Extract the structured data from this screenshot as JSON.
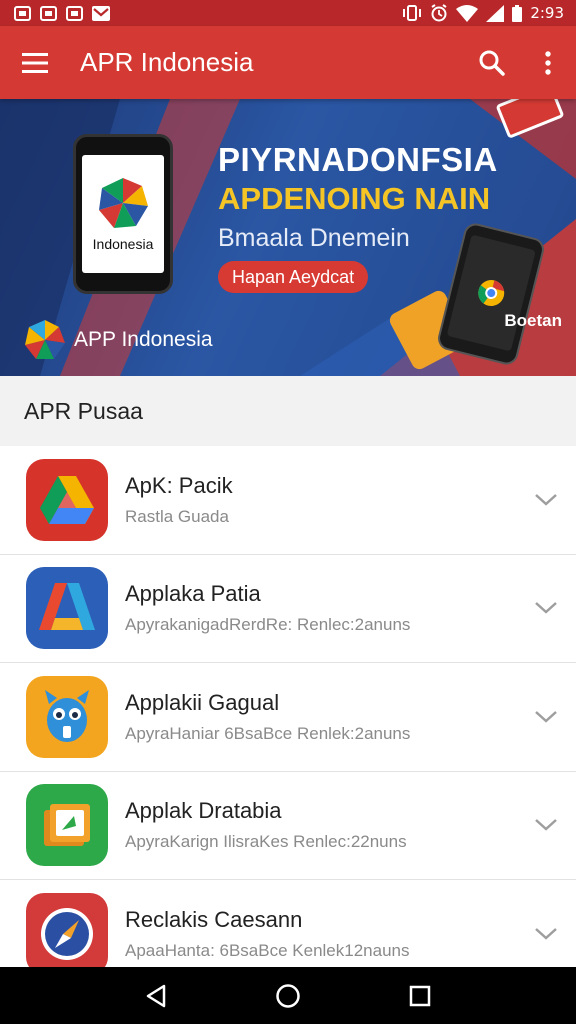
{
  "status_bar": {
    "time": "2:93",
    "icons": [
      "image-icon",
      "photo-icon",
      "gallery-icon",
      "gmail-icon",
      "vibrate-icon",
      "alarm-icon",
      "wifi-icon",
      "signal-icon",
      "battery-icon"
    ]
  },
  "app_bar": {
    "title": "APR Indonesia",
    "menu_icon": "hamburger-menu-icon",
    "search_icon": "search-icon",
    "overflow_icon": "more-vert-icon"
  },
  "banner": {
    "headline": "PIYRNADONFSIA",
    "subheadline": "APDENOING NAIN",
    "tagline": "Bmaala Dnemein",
    "cta_label": "Hapan Aeydcat",
    "phone_label": "Indonesia",
    "brand_text": "APP Indonesia",
    "corner_text": "Boetan"
  },
  "section": {
    "title": "APR Pusaa"
  },
  "apps": [
    {
      "title": "ApK: Pacik",
      "subtitle": "Rastla Guada",
      "icon": "drive-style-icon",
      "colors": [
        "#d6332a",
        "#f4b400",
        "#0f9d58",
        "#4285f4"
      ]
    },
    {
      "title": "Applaka Patia",
      "subtitle": "ApyrakanigadRerdRe: Renlec:2anuns",
      "icon": "triangle-a-icon",
      "colors": [
        "#2c5fb8",
        "#e94a2f",
        "#2fa8e0",
        "#f5b52a"
      ]
    },
    {
      "title": "Applakii Gagual",
      "subtitle": "ApyraHaniar 6BsaBce Renlek:2anuns",
      "icon": "blue-robot-icon",
      "colors": [
        "#f3a51f",
        "#2f8fd8"
      ]
    },
    {
      "title": "Applak Dratabia",
      "subtitle": "ApyraKarign IlisraKes Renlec:22nuns",
      "icon": "folder-app-icon",
      "colors": [
        "#2ea94a",
        "#f2a12a"
      ]
    },
    {
      "title": "Reclakis Caesann",
      "subtitle": "ApaaHanta: 6BsaBce Kenlek12nauns",
      "icon": "compass-app-icon",
      "colors": [
        "#d23b3a",
        "#2a4fa3"
      ]
    }
  ],
  "nav_bar": {
    "back_icon": "back-triangle-icon",
    "home_icon": "home-circle-icon",
    "recents_icon": "recents-square-icon"
  },
  "colors": {
    "primary": "#d43a33",
    "status_bar": "#b8282a",
    "banner_bg": "#23488e",
    "accent_yellow": "#f5c526"
  }
}
